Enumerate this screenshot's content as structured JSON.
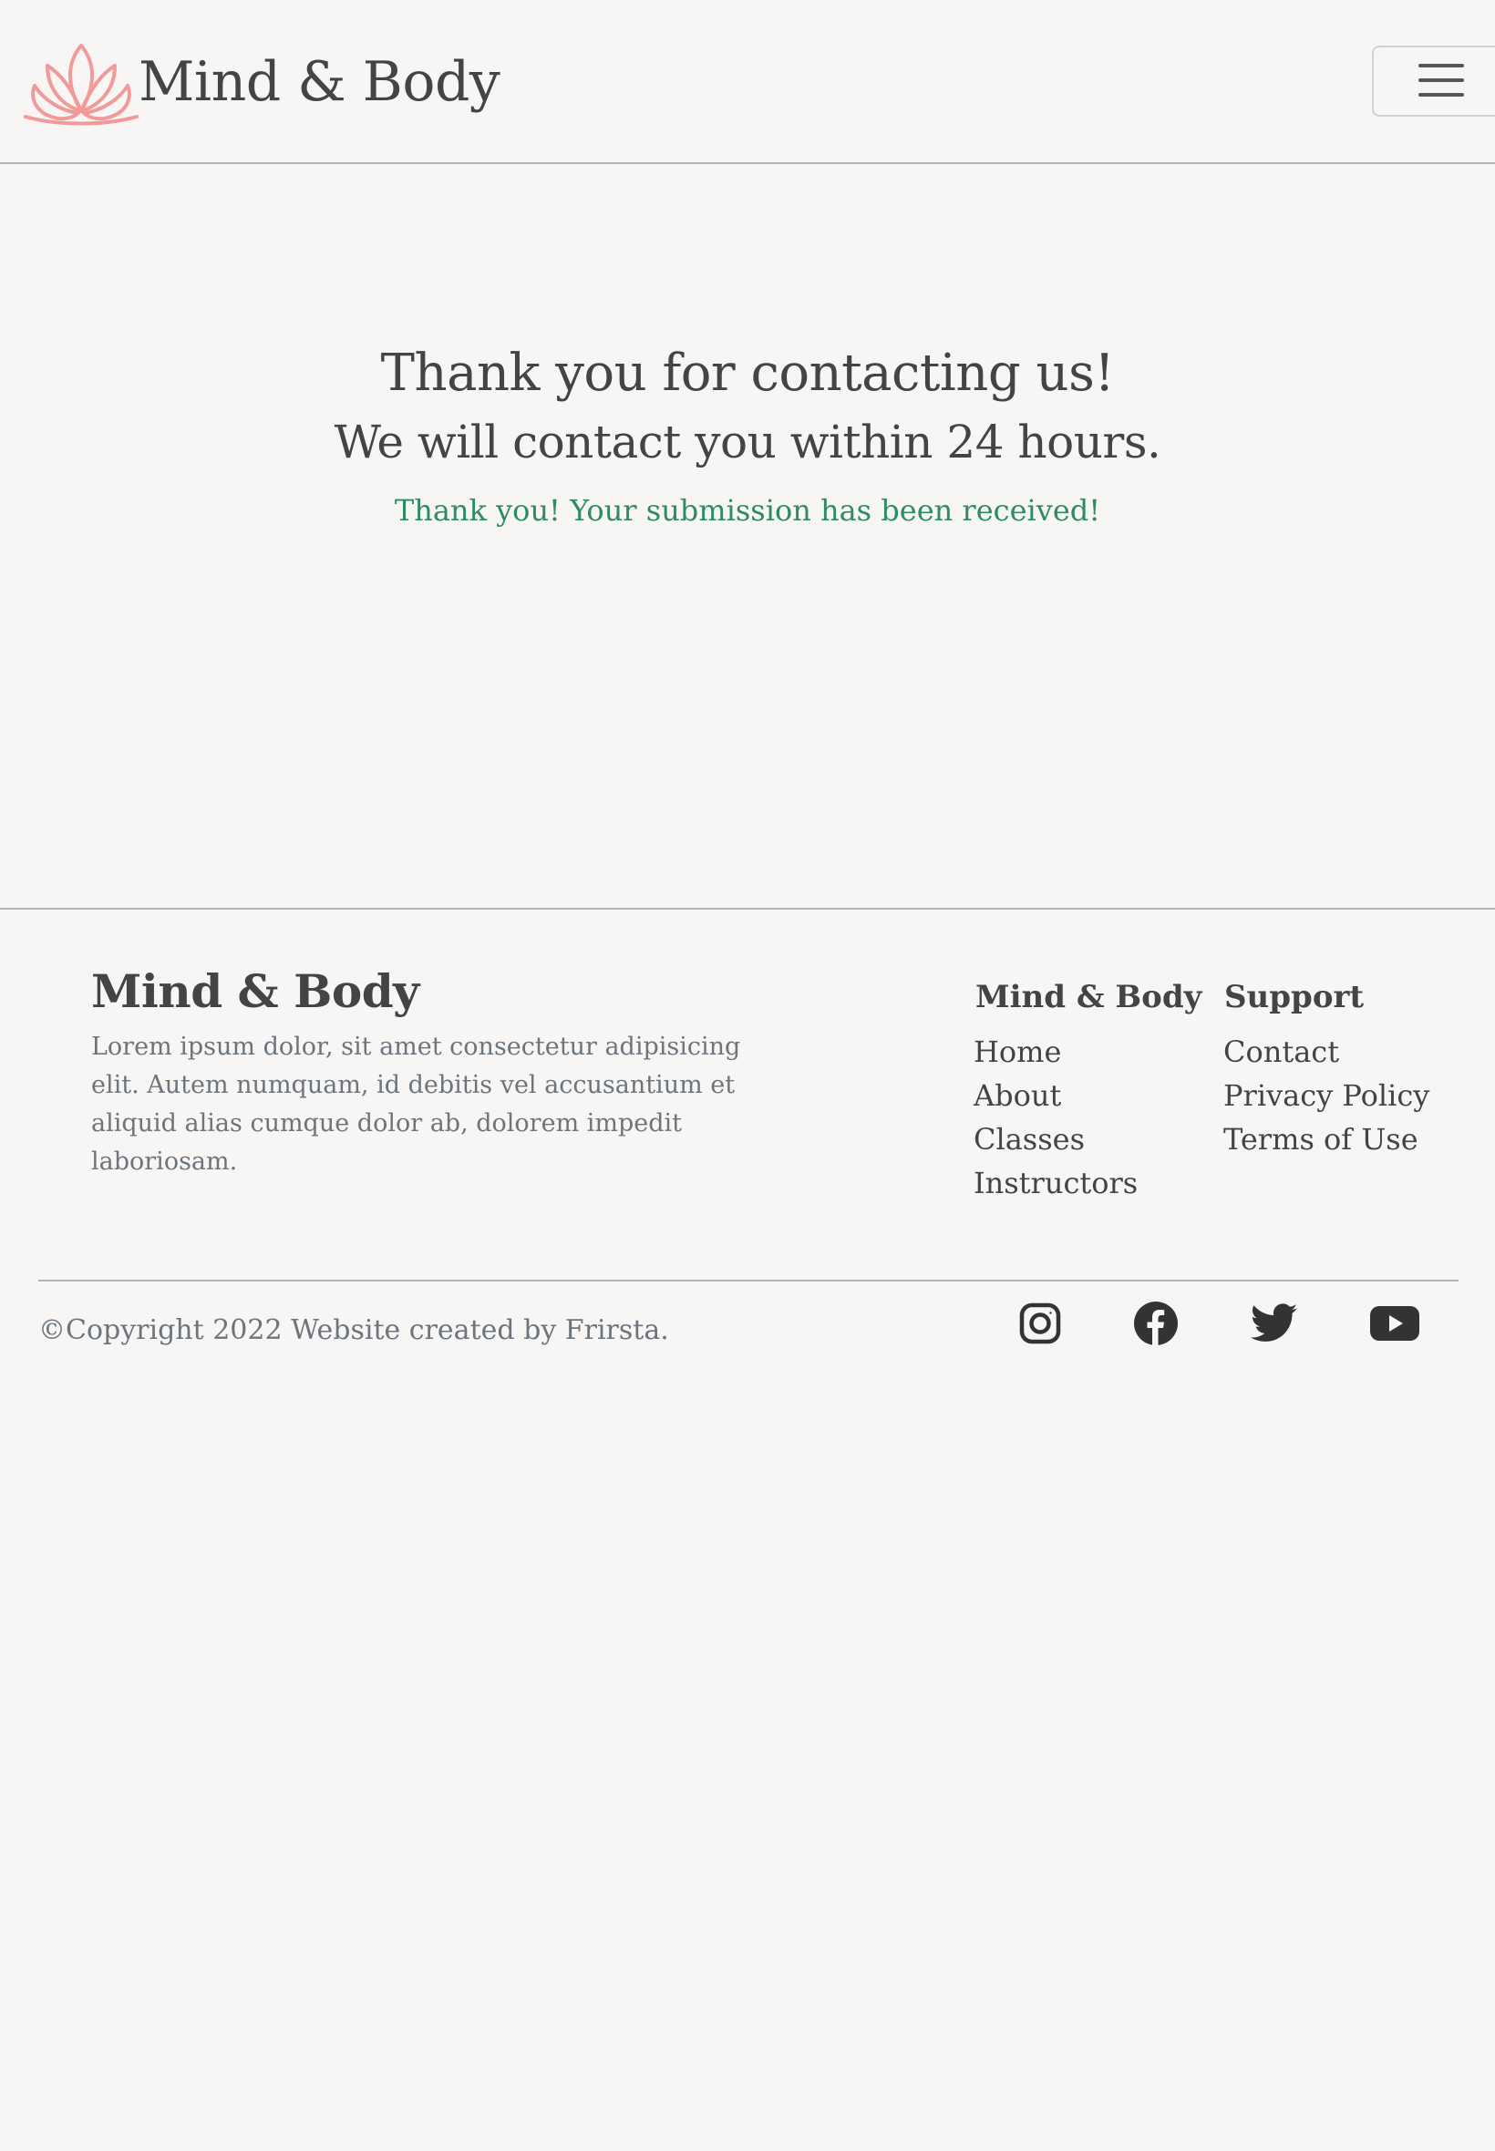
{
  "header": {
    "brand": "Mind & Body",
    "logo_icon": "lotus-icon",
    "menu_icon": "hamburger-menu-icon",
    "logo_color": "#f29a9a"
  },
  "main": {
    "title": "Thank you for contacting us!",
    "subtitle": "We will contact you within 24 hours.",
    "success_message": "Thank you! Your submission has been received!",
    "success_color": "#2e8b62"
  },
  "footer": {
    "brand": "Mind & Body",
    "description": "Lorem ipsum dolor, sit amet consectetur adipisicing elit. Autem numquam, id debitis vel accusantium et aliquid alias cumque dolor ab, dolorem impedit laboriosam.",
    "columns": [
      {
        "heading": "Mind & Body",
        "links": [
          "Home",
          "About",
          "Classes",
          "Instructors"
        ]
      },
      {
        "heading": "Support",
        "links": [
          "Contact",
          "Privacy Policy",
          "Terms of Use"
        ]
      }
    ],
    "copyright": "©Copyright 2022 Website created by Frirsta.",
    "social_icons": [
      "instagram-icon",
      "facebook-icon",
      "twitter-icon",
      "youtube-icon"
    ]
  }
}
